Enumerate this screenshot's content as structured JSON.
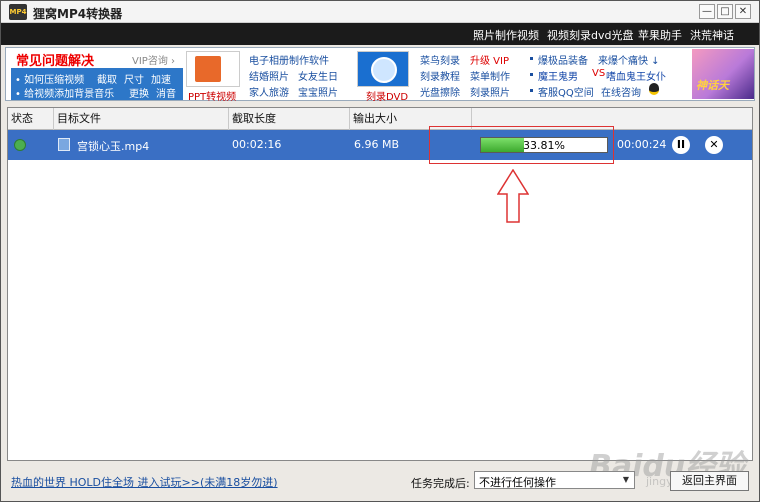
{
  "window": {
    "title": "狸窝MP4转换器",
    "app_icon_text": "MP4"
  },
  "window_controls": {
    "minimize": "—",
    "maximize": "□",
    "close": "✕"
  },
  "menu": [
    {
      "label": "照片制作视频"
    },
    {
      "label": "视频刻录dvd光盘"
    },
    {
      "label": "苹果助手"
    },
    {
      "label": "洪荒神话"
    }
  ],
  "banner": {
    "faq_title": "常见问题解决",
    "vip_consult": "VIP咨询 ›",
    "faq_links": [
      "• 如何压缩视频",
      "截取",
      "尺寸",
      "加速",
      "• 给视频添加背景音乐",
      "更换",
      "消音"
    ],
    "ppt_caption": "PPT转视频",
    "album_links": [
      "电子相册制作软件",
      "结婚照片",
      "女友生日",
      "家人旅游",
      "宝宝照片"
    ],
    "dvd_caption": "刻录DVD",
    "burn_links": [
      "菜鸟刻录",
      "升级 VIP",
      "刻录教程",
      "菜单制作",
      "光盘擦除",
      "刻录照片"
    ],
    "game_links": [
      "爆极品装备",
      "来爆个痛快 ↓",
      "魔王鬼男",
      "VS",
      "嗜血鬼王女仆",
      "客服QQ空间",
      "在线咨询"
    ],
    "game_logo": "神话天"
  },
  "table": {
    "columns": [
      "状态",
      "目标文件",
      "截取长度",
      "输出大小"
    ],
    "rows": [
      {
        "file": "宫锁心玉.mp4",
        "length": "00:02:16",
        "size": "6.96 MB",
        "progress_text": "33.81%",
        "progress": 0.3381,
        "remaining": "00:00:24"
      }
    ]
  },
  "row_controls": {
    "pause": "II",
    "cancel": "✕"
  },
  "bottom": {
    "promo_link": "热血的世界 HOLD住全场 进入试玩>>(未满18岁勿进)",
    "after_label": "任务完成后:",
    "after_value": "不进行任何操作",
    "back_button": "返回主界面"
  },
  "watermark": {
    "logo": "Baidu经验",
    "url": "jingyan.baidu.com"
  },
  "colors": {
    "row_highlight": "#3a6fc4",
    "progress": "#4cc23c",
    "annotation": "#dd3333",
    "menu_bar": "#1b1b1b"
  }
}
